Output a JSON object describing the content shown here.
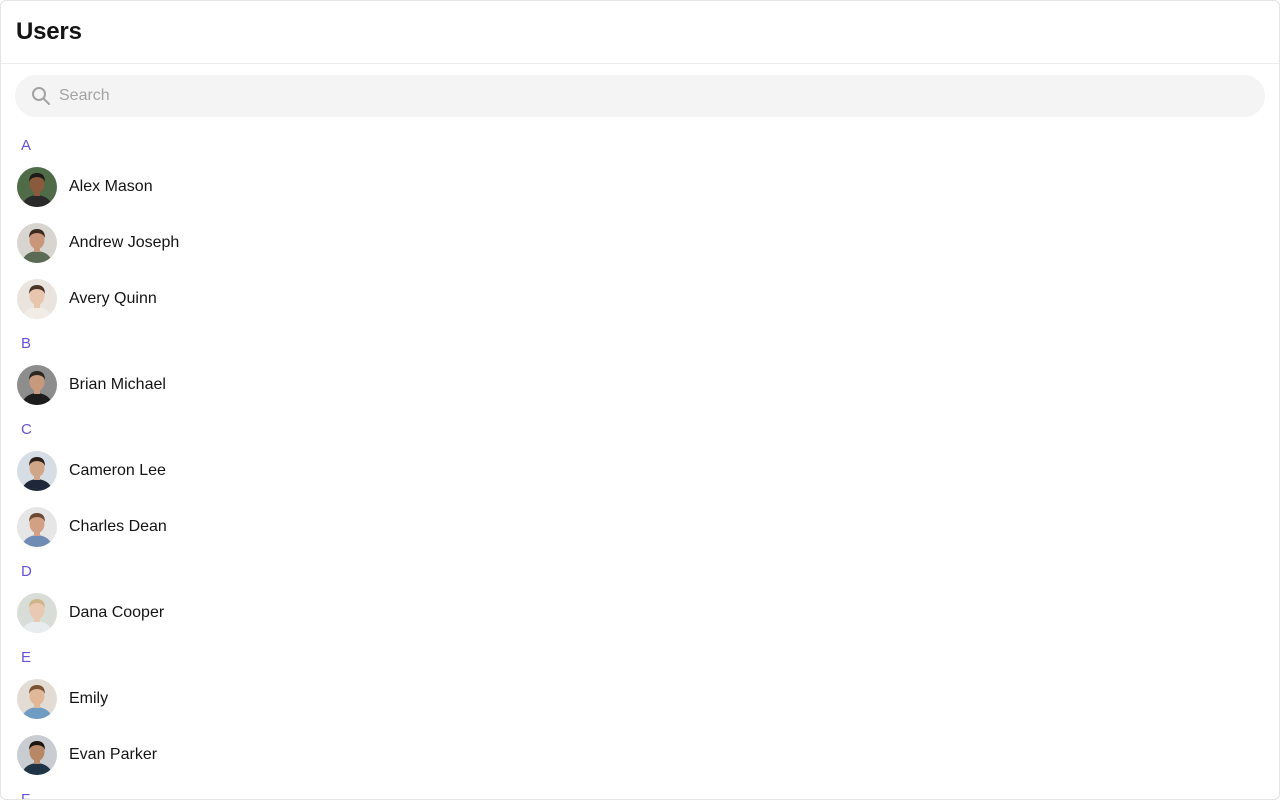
{
  "header": {
    "title": "Users"
  },
  "search": {
    "placeholder": "Search",
    "value": ""
  },
  "sections": [
    {
      "letter": "A",
      "users": [
        {
          "name": "Alex Mason",
          "bg": "#4f6b48",
          "skin": "#8a5a3c",
          "hair": "#1e1a17",
          "shirt": "#2a2a2a"
        },
        {
          "name": "Andrew Joseph",
          "bg": "#d8d4cf",
          "skin": "#c9967a",
          "hair": "#3b2a20",
          "shirt": "#5a6a55"
        },
        {
          "name": "Avery Quinn",
          "bg": "#e9e4de",
          "skin": "#e8c5ad",
          "hair": "#4a3427",
          "shirt": "#f1ece6"
        }
      ]
    },
    {
      "letter": "B",
      "users": [
        {
          "name": "Brian Michael",
          "bg": "#8d8d8d",
          "skin": "#c79a7d",
          "hair": "#2e2621",
          "shirt": "#1c1c1c"
        }
      ]
    },
    {
      "letter": "C",
      "users": [
        {
          "name": "Cameron Lee",
          "bg": "#d7dde4",
          "skin": "#d1a588",
          "hair": "#2c211a",
          "shirt": "#1f2838"
        },
        {
          "name": "Charles Dean",
          "bg": "#e6e6e6",
          "skin": "#d2a084",
          "hair": "#6b4a33",
          "shirt": "#6f8db4"
        }
      ]
    },
    {
      "letter": "D",
      "users": [
        {
          "name": "Dana Cooper",
          "bg": "#d9ddd7",
          "skin": "#eac9b2",
          "hair": "#cdb58a",
          "shirt": "#e9ecef"
        }
      ]
    },
    {
      "letter": "E",
      "users": [
        {
          "name": "Emily",
          "bg": "#e3dcd4",
          "skin": "#e1b897",
          "hair": "#7a5334",
          "shirt": "#6f9cc2"
        },
        {
          "name": "Evan Parker",
          "bg": "#c9cdd2",
          "skin": "#b88766",
          "hair": "#1b1612",
          "shirt": "#1f3347"
        }
      ]
    },
    {
      "letter": "F",
      "users": []
    }
  ],
  "colors": {
    "accent": "#6852d6",
    "search_bg": "#f4f4f4",
    "divider": "#ececec"
  },
  "icons": {
    "search": "search-icon"
  }
}
